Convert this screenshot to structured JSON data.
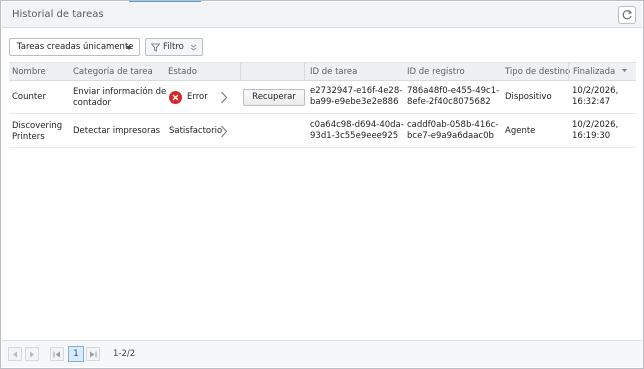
{
  "window": {
    "title": "Historial de tareas",
    "refresh_icon": "refresh-icon"
  },
  "toolbar": {
    "dropdown_value": "Tareas creadas únicamente",
    "filter_label": "Filtro"
  },
  "columns": {
    "name": "Nombre",
    "category": "Categoría de tarea",
    "status": "Estado",
    "task_id": "ID de tarea",
    "record_id": "ID de registro",
    "dest_type": "Tipo de destino",
    "finished": "Finalizada"
  },
  "rows": [
    {
      "name": "Counter",
      "category": [
        "Enviar información de",
        "contador"
      ],
      "status": "Error",
      "status_color": "#d9252a",
      "action": "Recuperar",
      "task_id": [
        "e2732947-e16f-4e28-",
        "ba99-e9ebe3e2e886"
      ],
      "record_id": [
        "786a48f0-e455-49c1-",
        "8efe-2f40c8075682"
      ],
      "dest_type": "Dispositivo",
      "finished": [
        "10/2/2026,",
        "16:32:47"
      ]
    },
    {
      "name": [
        "Discovering",
        "Printers"
      ],
      "category": "Detectar impresoras",
      "status": "Satisfactorio",
      "task_id": [
        "c0a64c98-d694-40da-",
        "93d1-3c55e9eee925"
      ],
      "record_id": [
        "caddf0ab-058b-416c-",
        "bce7-e9a9a6daac0b"
      ],
      "dest_type": "Agente",
      "finished": [
        "10/2/2026,",
        "16:19:30"
      ]
    }
  ],
  "pager": {
    "current_page": "1",
    "range": "1-2/2"
  }
}
